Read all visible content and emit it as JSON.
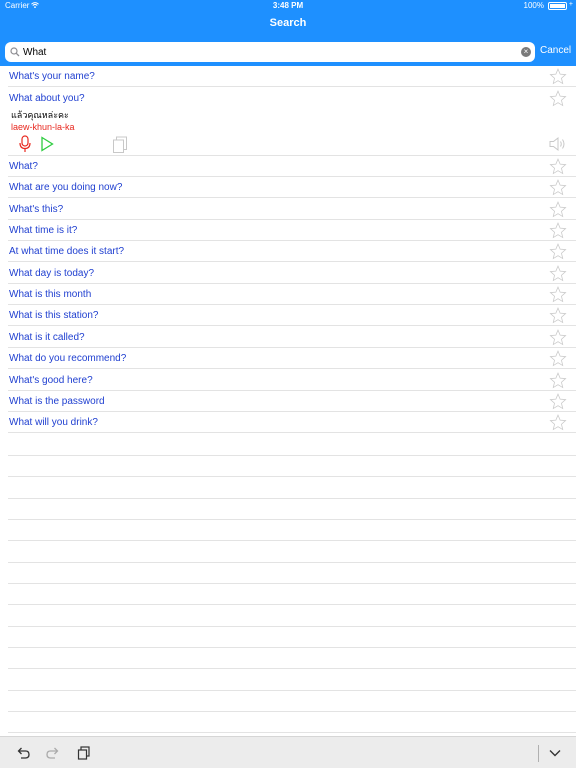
{
  "status": {
    "carrier": "Carrier",
    "time": "3:48 PM",
    "battery": "100%"
  },
  "nav": {
    "title": "Search"
  },
  "search": {
    "value": "What",
    "cancel_label": "Cancel"
  },
  "results": [
    "What's your name?",
    "What about you?",
    "What?",
    "What are you doing now?",
    "What's this?",
    "What time is it?",
    "At what time does it start?",
    "What day is today?",
    "What is this month",
    "What is this station?",
    "What is it called?",
    "What do you recommend?",
    "What's good here?",
    "What is the password",
    "What will you drink?"
  ],
  "expanded": {
    "phrase": "What about you?",
    "thai": "แล้วคุณหล่ะคะ",
    "romanization": "laew-khun-la-ka"
  },
  "colors": {
    "brand": "#1e90ff",
    "phrase_text": "#1f3fd0",
    "romanization": "#e8281f",
    "mic": "#e8281f",
    "play": "#2ecc40"
  }
}
